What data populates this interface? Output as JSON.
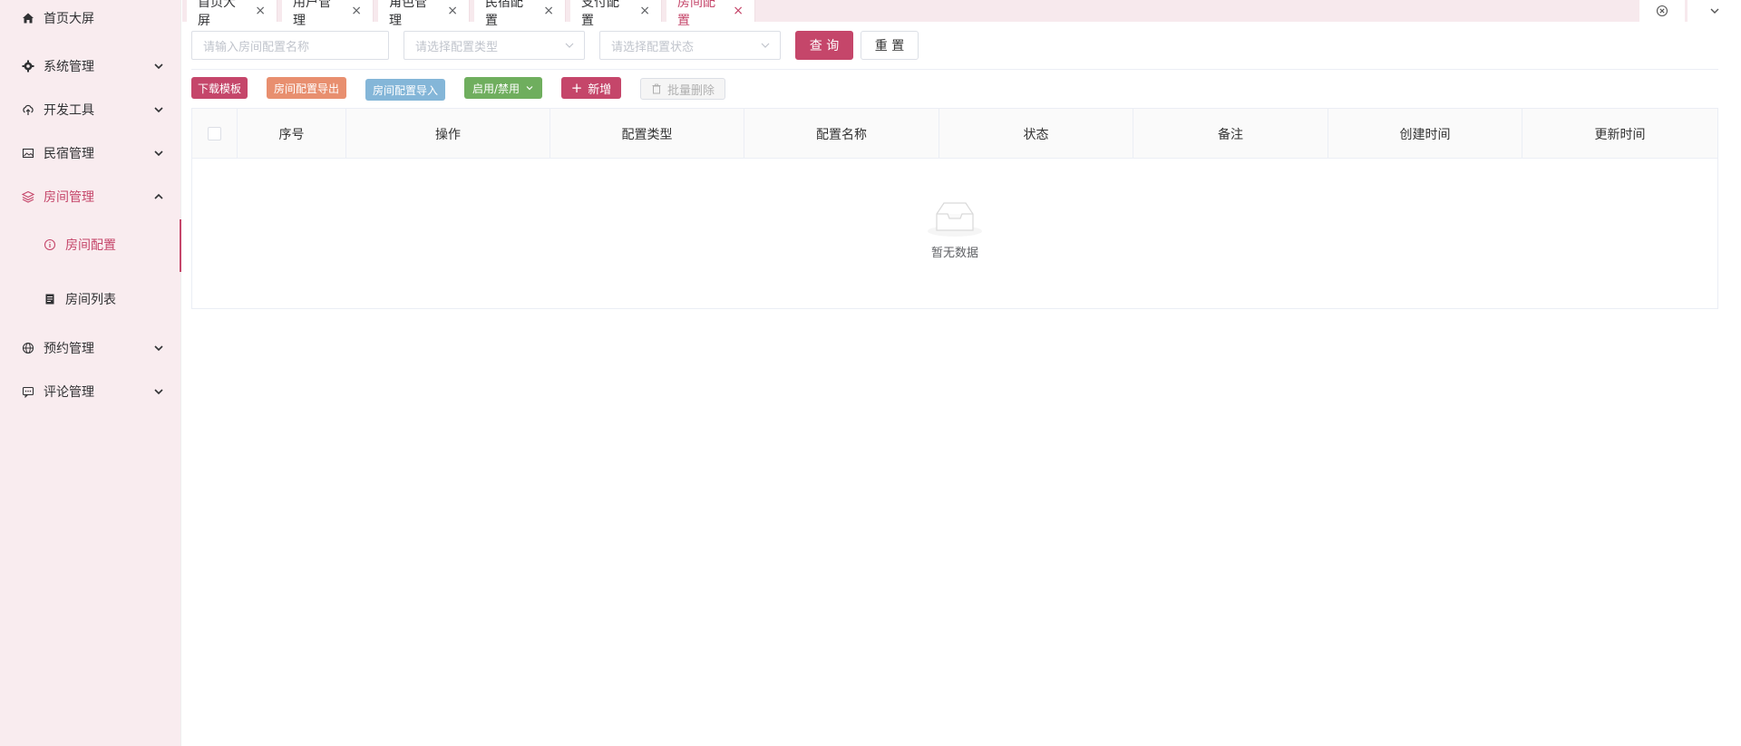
{
  "sidebar": {
    "items": [
      {
        "label": "首页大屏",
        "icon": "home-icon"
      },
      {
        "label": "系统管理",
        "icon": "gear-icon"
      },
      {
        "label": "开发工具",
        "icon": "upload-cloud-icon"
      },
      {
        "label": "民宿管理",
        "icon": "image-icon"
      },
      {
        "label": "房间管理",
        "icon": "layers-icon"
      },
      {
        "label": "预约管理",
        "icon": "globe-icon"
      },
      {
        "label": "评论管理",
        "icon": "message-icon"
      }
    ],
    "subitems": [
      {
        "label": "房间配置",
        "icon": "info-icon"
      },
      {
        "label": "房间列表",
        "icon": "document-icon"
      }
    ]
  },
  "tabs": [
    {
      "label": "首页大屏"
    },
    {
      "label": "用户管理"
    },
    {
      "label": "角色管理"
    },
    {
      "label": "民宿配置"
    },
    {
      "label": "支付配置"
    },
    {
      "label": "房间配置"
    }
  ],
  "search": {
    "name_placeholder": "请输入房间配置名称",
    "type_placeholder": "请选择配置类型",
    "status_placeholder": "请选择配置状态",
    "query_label": "查 询",
    "reset_label": "重 置"
  },
  "toolbar": {
    "download_template": "下载模板",
    "export": "房间配置导出",
    "import": "房间配置导入",
    "toggle": "启用/禁用",
    "add": "新增",
    "batch_delete": "批量删除"
  },
  "table": {
    "columns": [
      "序号",
      "操作",
      "配置类型",
      "配置名称",
      "状态",
      "备注",
      "创建时间",
      "更新时间"
    ],
    "empty_text": "暂无数据"
  },
  "colors": {
    "accent": "#c5466a",
    "export": "#e88f6f",
    "import": "#84b6d8",
    "toggle": "#6fae5e"
  }
}
